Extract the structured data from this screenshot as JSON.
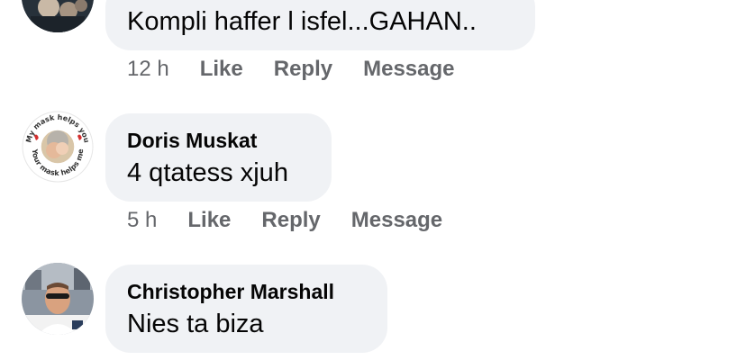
{
  "comments": [
    {
      "author": "",
      "text": "Kompli haffer l isfel...GAHAN..",
      "time": "12 h",
      "like": "Like",
      "reply": "Reply",
      "message": "Message"
    },
    {
      "author": "Doris Muskat",
      "avatar_frame_text": "My mask helps you. Your mask helps me.",
      "text": "4 qtatess xjuh",
      "time": "5 h",
      "like": "Like",
      "reply": "Reply",
      "message": "Message"
    },
    {
      "author": "Christopher Marshall",
      "text": "Nies ta biza"
    }
  ],
  "colors": {
    "bubble": "#f0f2f5",
    "text": "#050505",
    "secondary": "#65676b",
    "frame_red": "#d32f2f"
  }
}
